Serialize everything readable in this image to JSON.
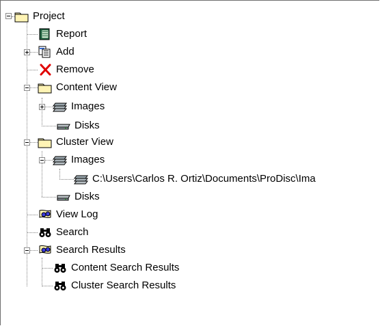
{
  "tree": {
    "nodes": [
      {
        "id": "project",
        "label": "Project",
        "icon": "folder-icon",
        "expanded": true
      },
      {
        "id": "report",
        "label": "Report",
        "icon": "report-icon"
      },
      {
        "id": "add",
        "label": "Add",
        "icon": "add-icon",
        "expanded": false
      },
      {
        "id": "remove",
        "label": "Remove",
        "icon": "remove-x-icon"
      },
      {
        "id": "content_view",
        "label": "Content View",
        "icon": "folder-icon",
        "expanded": true
      },
      {
        "id": "content_images",
        "label": "Images",
        "icon": "images-stack-icon",
        "expanded": false
      },
      {
        "id": "content_disks",
        "label": "Disks",
        "icon": "disk-icon"
      },
      {
        "id": "cluster_view",
        "label": "Cluster View",
        "icon": "folder-icon",
        "expanded": true
      },
      {
        "id": "cluster_images",
        "label": "Images",
        "icon": "images-stack-icon",
        "expanded": true
      },
      {
        "id": "image_path",
        "label": "C:\\Users\\Carlos R. Ortiz\\Documents\\ProDisc\\Ima",
        "icon": "image-file-icon"
      },
      {
        "id": "cluster_disks",
        "label": "Disks",
        "icon": "disk-icon"
      },
      {
        "id": "view_log",
        "label": "View Log",
        "icon": "view-log-icon"
      },
      {
        "id": "search",
        "label": "Search",
        "icon": "binoculars-icon"
      },
      {
        "id": "search_results",
        "label": "Search Results",
        "icon": "search-results-icon",
        "expanded": true
      },
      {
        "id": "content_search_results",
        "label": "Content Search Results",
        "icon": "binoculars-icon"
      },
      {
        "id": "cluster_search_results",
        "label": "Cluster Search Results",
        "icon": "binoculars-icon"
      }
    ]
  }
}
